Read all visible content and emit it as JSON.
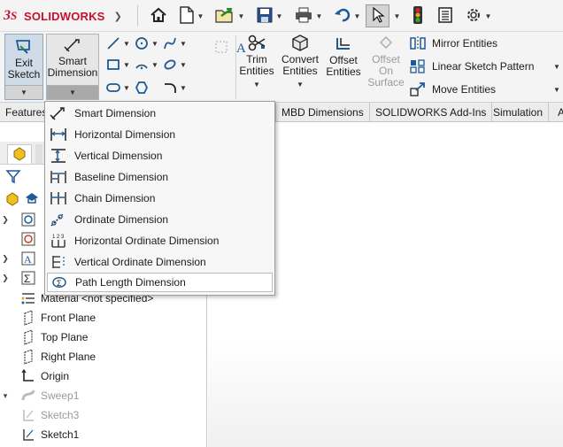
{
  "app": {
    "brand": "SOLIDWORKS",
    "logo_mark": "3DS"
  },
  "quick_access": {
    "items": [
      {
        "icon": "home-icon"
      },
      {
        "icon": "new-document-icon"
      },
      {
        "icon": "open-file-icon"
      },
      {
        "icon": "save-icon"
      },
      {
        "icon": "print-icon"
      },
      {
        "icon": "undo-icon"
      },
      {
        "icon": "select-pointer-icon"
      },
      {
        "icon": "rebuild-traffic-light-icon"
      },
      {
        "icon": "file-properties-icon"
      },
      {
        "icon": "options-gear-icon"
      }
    ]
  },
  "ribbon": {
    "exit_sketch": {
      "line1": "Exit",
      "line2": "Sketch"
    },
    "smart_dimension": {
      "line1": "Smart",
      "line2": "Dimension"
    },
    "trim_entities": {
      "line1": "Trim",
      "line2": "Entities"
    },
    "convert_entities": {
      "line1": "Convert",
      "line2": "Entities"
    },
    "offset_entities": {
      "line1": "Offset",
      "line2": "Entities"
    },
    "offset_on_surface": {
      "line1": "Offset",
      "line2": "On",
      "line3": "Surface"
    },
    "mirror_entities": "Mirror Entities",
    "linear_sketch_pattern": "Linear Sketch Pattern",
    "move_entities": "Move Entities"
  },
  "tabs": [
    {
      "label": "Features"
    },
    {
      "label": "MBD Dimensions"
    },
    {
      "label": "SOLIDWORKS Add-Ins"
    },
    {
      "label": "Simulation"
    },
    {
      "label": "A"
    }
  ],
  "menu": {
    "items": [
      {
        "label": "Smart Dimension",
        "icon": "smart-dimension-icon"
      },
      {
        "label": "Horizontal Dimension",
        "icon": "horizontal-dimension-icon"
      },
      {
        "label": "Vertical Dimension",
        "icon": "vertical-dimension-icon"
      },
      {
        "label": "Baseline Dimension",
        "icon": "baseline-dimension-icon"
      },
      {
        "label": "Chain Dimension",
        "icon": "chain-dimension-icon"
      },
      {
        "label": "Ordinate Dimension",
        "icon": "ordinate-dimension-icon"
      },
      {
        "label": "Horizontal Ordinate Dimension",
        "icon": "horizontal-ordinate-icon",
        "icon_text": "1 2 3"
      },
      {
        "label": "Vertical Ordinate Dimension",
        "icon": "vertical-ordinate-icon"
      },
      {
        "label": "Path Length Dimension",
        "icon": "path-length-icon"
      }
    ]
  },
  "tree": {
    "material": "Material <not specified>",
    "items": [
      {
        "label": "Front Plane",
        "icon": "plane-icon"
      },
      {
        "label": "Top Plane",
        "icon": "plane-icon"
      },
      {
        "label": "Right Plane",
        "icon": "plane-icon"
      },
      {
        "label": "Origin",
        "icon": "origin-icon"
      },
      {
        "label": "Sweep1",
        "icon": "sweep-icon",
        "suppressed": true
      },
      {
        "label": "Sketch3",
        "icon": "sketch-icon",
        "suppressed": true
      },
      {
        "label": "Sketch1",
        "icon": "sketch-icon",
        "suppressed": false
      }
    ]
  },
  "colors": {
    "brand_red": "#c8102e",
    "accent_blue": "#1e5a96",
    "highlight": "#ffffff"
  }
}
